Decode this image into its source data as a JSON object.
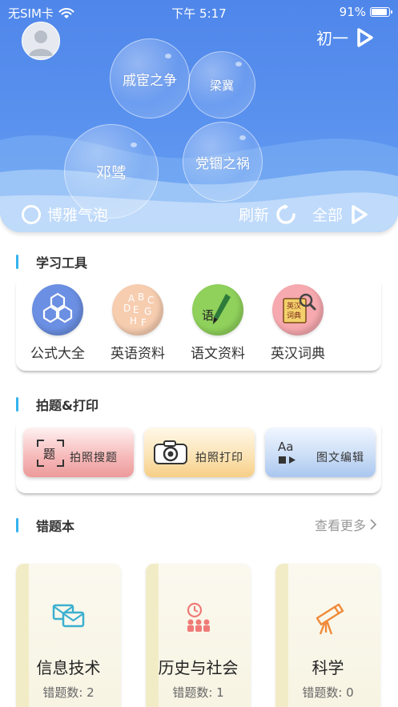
{
  "status_bar": {
    "carrier": "无SIM卡",
    "time": "下午 5:17",
    "battery": "91%"
  },
  "header": {
    "grade": "初一"
  },
  "bubbles": [
    "戚宦之争",
    "梁冀",
    "邓骘",
    "党锢之祸"
  ],
  "hero_bar": {
    "left_label": "博雅气泡",
    "refresh_label": "刷新",
    "all_label": "全部"
  },
  "tools_section": {
    "title": "学习工具",
    "items": [
      {
        "label": "公式大全",
        "icon": "hexagon-formula-icon",
        "color": "#6a8ee0"
      },
      {
        "label": "英语资料",
        "icon": "letters-english-icon",
        "color": "#f6c9aa"
      },
      {
        "label": "语文资料",
        "icon": "brush-chinese-icon",
        "color": "#8fd05a"
      },
      {
        "label": "英汉词典",
        "icon": "dictionary-icon",
        "color": "#f5a7ad"
      }
    ]
  },
  "photo_section": {
    "title": "拍题&打印",
    "items": [
      {
        "label": "拍照搜题",
        "icon_text": "题",
        "icon": "scan-question-icon"
      },
      {
        "label": "拍照打印",
        "icon": "camera-icon"
      },
      {
        "label": "图文编辑",
        "icon_text": "Aa",
        "icon": "text-image-edit-icon"
      }
    ]
  },
  "wrong_section": {
    "title": "错题本",
    "more_label": "查看更多",
    "count_prefix": "错题数",
    "books": [
      {
        "name": "信息技术",
        "count": "错题数: 2",
        "icon": "envelopes-icon"
      },
      {
        "name": "历史与社会",
        "count": "错题数: 1",
        "icon": "clock-people-icon"
      },
      {
        "name": "科学",
        "count": "错题数: 0",
        "icon": "telescope-icon"
      }
    ]
  }
}
